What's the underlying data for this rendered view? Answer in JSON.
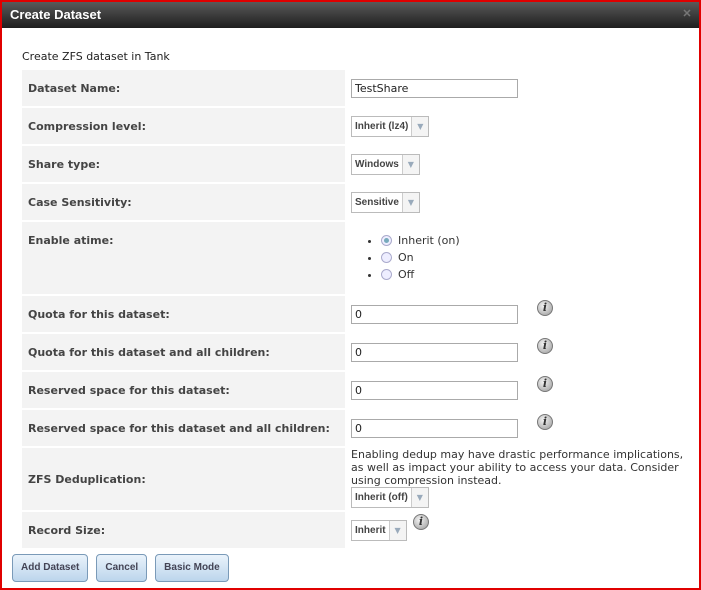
{
  "title": "Create Dataset",
  "intro": "Create ZFS dataset in Tank",
  "fields": {
    "name": {
      "label": "Dataset Name:",
      "value": "TestShare"
    },
    "compression": {
      "label": "Compression level:",
      "value": "Inherit (lz4)"
    },
    "share": {
      "label": "Share type:",
      "value": "Windows"
    },
    "case": {
      "label": "Case Sensitivity:",
      "value": "Sensitive"
    },
    "atime": {
      "label": "Enable atime:",
      "options": [
        "Inherit (on)",
        "On",
        "Off"
      ],
      "selected": "Inherit (on)"
    },
    "quota": {
      "label": "Quota for this dataset:",
      "value": "0"
    },
    "quota_children": {
      "label": "Quota for this dataset and all children:",
      "value": "0"
    },
    "reserved": {
      "label": "Reserved space for this dataset:",
      "value": "0"
    },
    "reserved_children": {
      "label": "Reserved space for this dataset and all children:",
      "value": "0"
    },
    "dedup": {
      "label": "ZFS Deduplication:",
      "note": "Enabling dedup may have drastic performance implications, as well as impact your ability to access your data. Consider using compression instead.",
      "value": "Inherit (off)"
    },
    "recordsize": {
      "label": "Record Size:",
      "value": "Inherit"
    }
  },
  "buttons": {
    "add": "Add Dataset",
    "cancel": "Cancel",
    "basic": "Basic Mode"
  }
}
